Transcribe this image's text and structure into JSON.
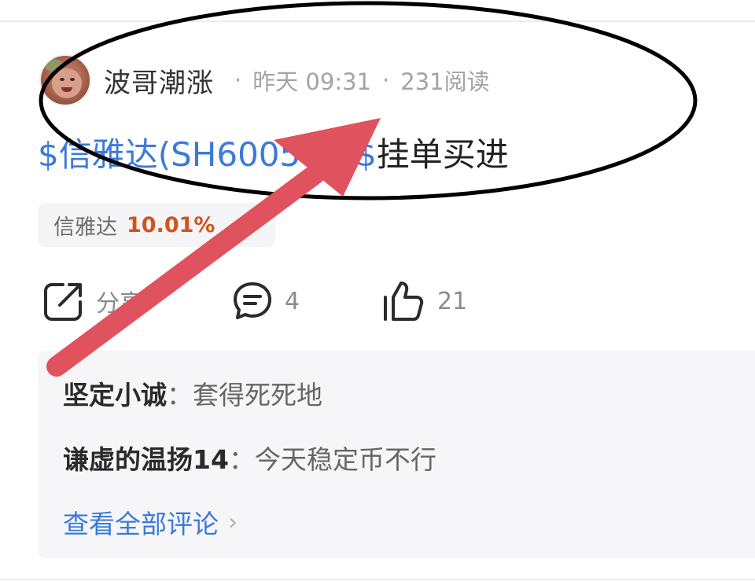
{
  "post": {
    "author": "波哥潮涨",
    "sep1": "·",
    "time": "昨天 09:31",
    "sep2": "·",
    "reads": "231阅读",
    "stock_link": "$信雅达(SH600571)$",
    "title_text": "挂单买进",
    "tag": {
      "name": "信雅达",
      "change": "10.01%"
    }
  },
  "actions": {
    "share_label": "分享",
    "comment_count": "4",
    "like_count": "21"
  },
  "comments": [
    {
      "author": "坚定小诚",
      "sep": "：",
      "text": "套得死死地"
    },
    {
      "author": "谦虚的温扬14",
      "sep": "：",
      "text": "今天稳定币不行"
    }
  ],
  "view_all_label": "查看全部评论",
  "view_all_chevron": "›",
  "colors": {
    "link_blue": "#3b7ad9",
    "gain_orange": "#d0541d",
    "annotation_arrow": "#e0525e",
    "annotation_ellipse": "#000000"
  },
  "icons": [
    "share-icon",
    "comment-icon",
    "like-icon",
    "chevron-right-icon"
  ]
}
